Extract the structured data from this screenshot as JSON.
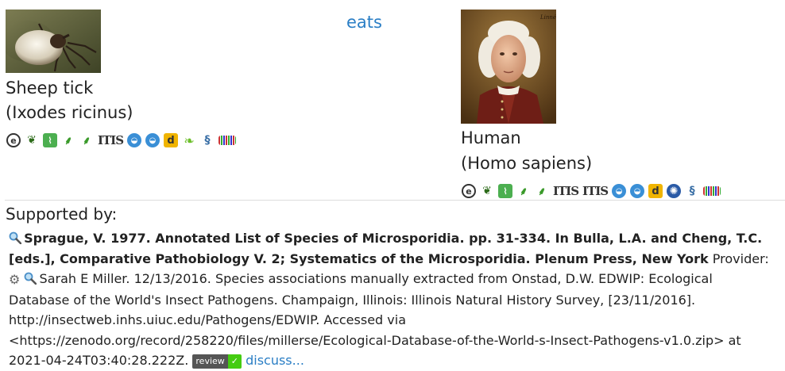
{
  "source": {
    "common_name": "Sheep tick",
    "scientific_name": "(Ixodes ricinus)"
  },
  "relation": "eats",
  "target": {
    "common_name": "Human",
    "scientific_name": "(Homo sapiens)"
  },
  "source_icons": [
    "eol-icon",
    "gbif-leaf-icon",
    "map-icon",
    "ncbi-plant-icon",
    "ncbi-plant-icon",
    "itis-label",
    "ala-icon",
    "ala-icon",
    "d-icon",
    "leaf-icon",
    "dna-icon",
    "barcode-icon"
  ],
  "target_icons": [
    "eol-icon",
    "gbif-leaf-icon",
    "map-icon",
    "ncbi-plant-icon",
    "ncbi-plant-icon",
    "itis-label",
    "itis-label",
    "ala-icon",
    "ala-icon",
    "d-icon",
    "globe-icon",
    "dna-icon",
    "barcode-icon"
  ],
  "itis_label": "ITIS",
  "d_label": "d",
  "supported_label": "Supported by:",
  "reference": {
    "citation": "Sprague, V. 1977. Annotated List of Species of Microsporidia. pp. 31-334. In Bulla, L.A. and Cheng, T.C. [eds.], Comparative Pathobiology V. 2; Systematics of the Microsporidia. Plenum Press, New York",
    "provider_label": "Provider:",
    "provider_text": "Sarah E Miller. 12/13/2016. Species associations manually extracted from Onstad, D.W. EDWIP: Ecological Database of the World's Insect Pathogens. Champaign, Illinois: Illinois Natural History Survey, [23/11/2016]. http://insectweb.inhs.uiuc.edu/Pathogens/EDWIP. Accessed via <https://zenodo.org/record/258220/files/millerse/Ecological-Database-of-the-World-s-Insect-Pathogens-v1.0.zip> at 2021-04-24T03:40:28.222Z.",
    "review_label": "review",
    "review_check": "✓",
    "discuss_label": "discuss..."
  },
  "colors": {
    "link": "#2a7ec5",
    "badge_dark": "#555555",
    "badge_green": "#44cc11"
  }
}
